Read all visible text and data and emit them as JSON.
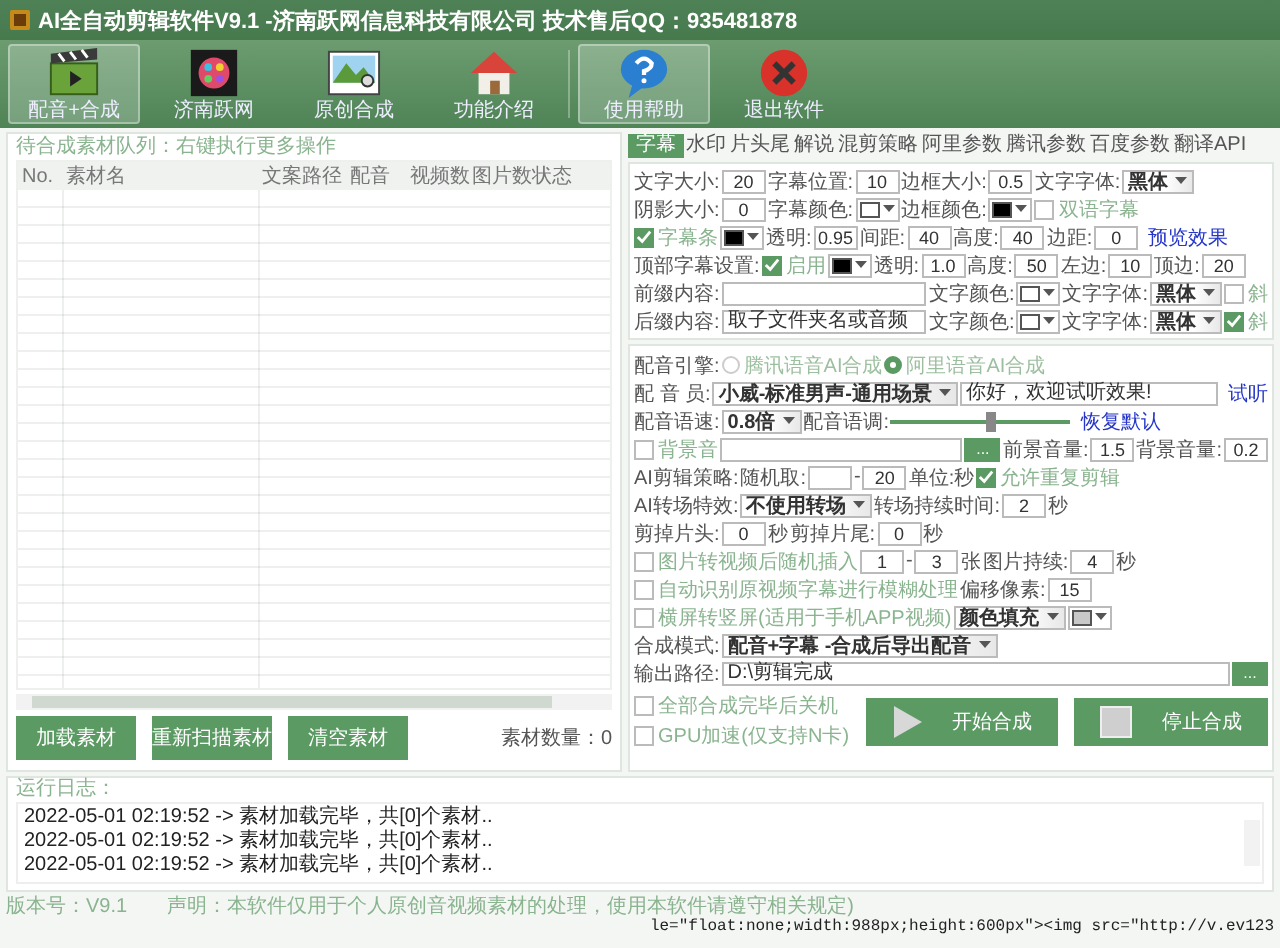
{
  "window": {
    "title": "AI全自动剪辑软件V9.1 -济南跃网信息科技有限公司 技术售后QQ：935481878"
  },
  "toolbar": [
    {
      "label": "配音+合成",
      "highlighted": true
    },
    {
      "label": "济南跃网",
      "highlighted": false
    },
    {
      "label": "原创合成",
      "highlighted": false
    },
    {
      "label": "功能介绍",
      "highlighted": false
    },
    {
      "label": "使用帮助",
      "highlighted": true
    },
    {
      "label": "退出软件",
      "highlighted": false
    }
  ],
  "queue": {
    "title": "待合成素材队列：右键执行更多操作",
    "columns": [
      "No.",
      "素材名",
      "文案路径",
      "配音",
      "视频数",
      "图片数",
      "状态"
    ],
    "buttons": [
      "加载素材",
      "重新扫描素材",
      "清空素材"
    ],
    "count": "素材数量：0"
  },
  "tabs": [
    {
      "label": "字幕",
      "selected": true
    },
    {
      "label": "水印",
      "selected": false
    },
    {
      "label": "片头尾",
      "selected": false
    },
    {
      "label": "解说",
      "selected": false
    },
    {
      "label": "混剪策略",
      "selected": false
    },
    {
      "label": "阿里参数",
      "selected": false
    },
    {
      "label": "腾讯参数",
      "selected": false
    },
    {
      "label": "百度参数",
      "selected": false
    },
    {
      "label": "翻译API",
      "selected": false
    }
  ],
  "subtitle_settings": {
    "rows": [
      {
        "items": [
          {
            "kind": "label",
            "text": "文字大小:"
          },
          {
            "kind": "field",
            "value": "20"
          },
          {
            "kind": "label",
            "text": "字幕位置:"
          },
          {
            "kind": "field",
            "value": "10"
          },
          {
            "kind": "label",
            "text": "边框大小:"
          },
          {
            "kind": "field",
            "value": "0.5"
          },
          {
            "kind": "label",
            "text": "文字字体:"
          },
          {
            "kind": "select",
            "value": "黑体"
          }
        ]
      },
      {
        "items": [
          {
            "kind": "label",
            "text": "阴影大小:"
          },
          {
            "kind": "field",
            "value": "0"
          },
          {
            "kind": "label",
            "text": "字幕颜色:"
          },
          {
            "kind": "color",
            "color": "#ffffff"
          },
          {
            "kind": "label",
            "text": "边框颜色:"
          },
          {
            "kind": "color",
            "color": "#000000"
          },
          {
            "kind": "check",
            "text": "双语字幕",
            "checked": false
          }
        ]
      },
      {
        "items": [
          {
            "kind": "check",
            "text": "字幕条",
            "checked": true
          },
          {
            "kind": "color",
            "color": "#000000"
          },
          {
            "kind": "label",
            "text": "透明:"
          },
          {
            "kind": "field",
            "value": "0.95"
          },
          {
            "kind": "label",
            "text": "间距:"
          },
          {
            "kind": "field",
            "value": "40"
          },
          {
            "kind": "label",
            "text": "高度:"
          },
          {
            "kind": "field",
            "value": "40"
          },
          {
            "kind": "label",
            "text": "边距:"
          },
          {
            "kind": "field",
            "value": "0"
          },
          {
            "kind": "link",
            "text": "预览效果"
          }
        ]
      },
      {
        "items": [
          {
            "kind": "label",
            "text": "顶部字幕设置:"
          },
          {
            "kind": "check",
            "text": "启用",
            "checked": true
          },
          {
            "kind": "color",
            "color": "#000000"
          },
          {
            "kind": "label",
            "text": "透明:"
          },
          {
            "kind": "field",
            "value": "1.0"
          },
          {
            "kind": "label",
            "text": "高度:"
          },
          {
            "kind": "field",
            "value": "50"
          },
          {
            "kind": "label",
            "text": "左边:"
          },
          {
            "kind": "field",
            "value": "10"
          },
          {
            "kind": "label",
            "text": "顶边:"
          },
          {
            "kind": "field",
            "value": "20"
          }
        ]
      },
      {
        "items": [
          {
            "kind": "label",
            "text": "前缀内容:"
          },
          {
            "kind": "text_field"
          },
          {
            "kind": "label",
            "text": "文字颜色:"
          },
          {
            "kind": "color",
            "color": "#ffffff"
          },
          {
            "kind": "label",
            "text": "文字字体:"
          },
          {
            "kind": "select",
            "value": "黑体"
          },
          {
            "kind": "check",
            "text": "斜",
            "checked": false
          }
        ]
      },
      {
        "items": [
          {
            "kind": "label",
            "text": "后缀内容:"
          },
          {
            "kind": "text_field",
            "value": "取子文件夹名或音频"
          },
          {
            "kind": "label",
            "text": "文字颜色:"
          },
          {
            "kind": "color",
            "color": "#ffffff"
          },
          {
            "kind": "label",
            "text": "文字字体:"
          },
          {
            "kind": "select",
            "value": "黑体"
          },
          {
            "kind": "check",
            "text": "斜",
            "checked": true
          }
        ]
      }
    ]
  },
  "voice_settings": {
    "rows": [
      {
        "items": [
          {
            "kind": "label",
            "text": "配音引擎:"
          },
          {
            "kind": "radio",
            "text": "腾讯语音AI合成",
            "selected": false
          },
          {
            "kind": "radio",
            "text": "阿里语音AI合成",
            "selected": true
          }
        ]
      },
      {
        "items": [
          {
            "kind": "label",
            "text": "配 音 员:"
          },
          {
            "kind": "select",
            "value": "小威-标准男声-通用场景"
          },
          {
            "kind": "text_field",
            "value": "你好，欢迎试听效果!"
          },
          {
            "kind": "link",
            "text": "试听"
          }
        ]
      },
      {
        "items": [
          {
            "kind": "label",
            "text": "配音语速:"
          },
          {
            "kind": "select",
            "value": "0.8倍"
          },
          {
            "kind": "label",
            "text": "配音语调:"
          },
          {
            "kind": "slider",
            "level": 0.55
          },
          {
            "kind": "link",
            "text": "恢复默认"
          }
        ]
      },
      {
        "items": [
          {
            "kind": "check",
            "text": "背景音",
            "checked": false
          },
          {
            "kind": "text_field"
          },
          {
            "kind": "browse",
            "text": "..."
          },
          {
            "kind": "label",
            "text": "前景音量:"
          },
          {
            "kind": "field",
            "value": "1.5"
          },
          {
            "kind": "label",
            "text": "背景音量:"
          },
          {
            "kind": "field",
            "value": "0.2"
          }
        ]
      },
      {
        "items": [
          {
            "kind": "label",
            "text": "AI剪辑策略:"
          },
          {
            "kind": "label",
            "text": "随机取:"
          },
          {
            "kind": "field"
          },
          {
            "kind": "label",
            "text": "-"
          },
          {
            "kind": "field",
            "value": "20"
          },
          {
            "kind": "label",
            "text": "单位:秒"
          },
          {
            "kind": "check",
            "text": "允许重复剪辑",
            "checked": true
          }
        ]
      },
      {
        "items": [
          {
            "kind": "label",
            "text": "AI转场特效:"
          },
          {
            "kind": "select",
            "value": "不使用转场"
          },
          {
            "kind": "label",
            "text": "转场持续时间:"
          },
          {
            "kind": "field",
            "value": "2"
          },
          {
            "kind": "label",
            "text": "秒"
          }
        ]
      },
      {
        "items": [
          {
            "kind": "label",
            "text": "剪掉片头:"
          },
          {
            "kind": "field",
            "value": "0"
          },
          {
            "kind": "label",
            "text": "秒"
          },
          {
            "kind": "label",
            "text": "剪掉片尾:"
          },
          {
            "kind": "field",
            "value": "0"
          },
          {
            "kind": "label",
            "text": "秒"
          }
        ]
      },
      {
        "items": [
          {
            "kind": "check",
            "text": "图片转视频后随机插入",
            "checked": false
          },
          {
            "kind": "field",
            "value": "1"
          },
          {
            "kind": "label",
            "text": "-"
          },
          {
            "kind": "field",
            "value": "3"
          },
          {
            "kind": "label",
            "text": "张"
          },
          {
            "kind": "label",
            "text": "图片持续:"
          },
          {
            "kind": "field",
            "value": "4"
          },
          {
            "kind": "label",
            "text": "秒"
          }
        ]
      },
      {
        "items": [
          {
            "kind": "check",
            "text": "自动识别原视频字幕进行模糊处理",
            "checked": false
          },
          {
            "kind": "label",
            "text": "偏移像素:"
          },
          {
            "kind": "field",
            "value": "15"
          }
        ]
      },
      {
        "items": [
          {
            "kind": "check",
            "text": "横屏转竖屏(适用于手机APP视频)",
            "checked": false
          },
          {
            "kind": "select",
            "value": "颜色填充"
          },
          {
            "kind": "color",
            "color": "#c8c8c8"
          }
        ]
      },
      {
        "items": [
          {
            "kind": "label",
            "text": "合成模式:"
          },
          {
            "kind": "select",
            "value": "配音+字幕 -合成后导出配音"
          }
        ]
      },
      {
        "items": [
          {
            "kind": "label",
            "text": "输出路径:"
          },
          {
            "kind": "text_field",
            "value": "D:\\剪辑完成"
          },
          {
            "kind": "browse",
            "text": "..."
          }
        ]
      }
    ],
    "options": [
      {
        "text": "全部合成完毕后关机",
        "checked": false
      },
      {
        "text": "GPU加速(仅支持N卡)",
        "checked": false
      }
    ],
    "start_button": "开始合成",
    "stop_button": "停止合成"
  },
  "log": {
    "title": "运行日志：",
    "lines": [
      "2022-05-01 02:19:52 -> 素材加载完毕，共[0]个素材..",
      "2022-05-01 02:19:52 -> 素材加载完毕，共[0]个素材..",
      "2022-05-01 02:19:52 -> 素材加载完毕，共[0]个素材.."
    ]
  },
  "status_bar": {
    "version": "版本号：V9.1",
    "notice": "声明：本软件仅用于个人原创音视频素材的处理，使用本软件请遵守相关规定)",
    "overflow_text": "le=\"float:none;width:988px;height:600px\"><img src=\"http://v.ev123"
  }
}
